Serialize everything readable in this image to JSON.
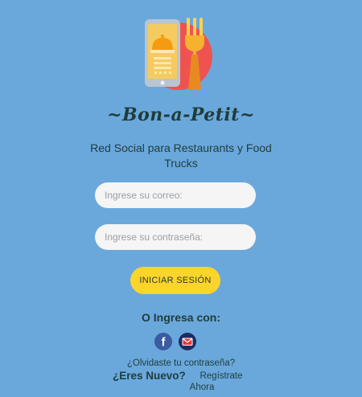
{
  "brand": {
    "name": "~Bon-a-Petit~",
    "tagline": "Red Social para Restaurants y Food Trucks",
    "logo_icon": "phone-cloche-fork-icon"
  },
  "login": {
    "email_placeholder": "Ingrese su correo:",
    "password_placeholder": "Ingrese su contraseña:",
    "submit_label": "INICIAR SESIÓN"
  },
  "social": {
    "heading": "O Ingresa con:",
    "providers": [
      {
        "name": "facebook",
        "icon": "facebook-icon",
        "label": "f",
        "color": "#3b5aa0"
      },
      {
        "name": "email",
        "icon": "mail-icon",
        "color": "#1e2b63"
      }
    ]
  },
  "footer": {
    "forgot_label": "¿Olvidaste tu contraseña?",
    "new_user_label": "¿Eres Nuevo?",
    "register_label_line1": "Regístrate",
    "register_label_line2": "Ahora"
  },
  "colors": {
    "background": "#6aa8dc",
    "accent": "#fbd529",
    "text": "#1f3c3a"
  }
}
